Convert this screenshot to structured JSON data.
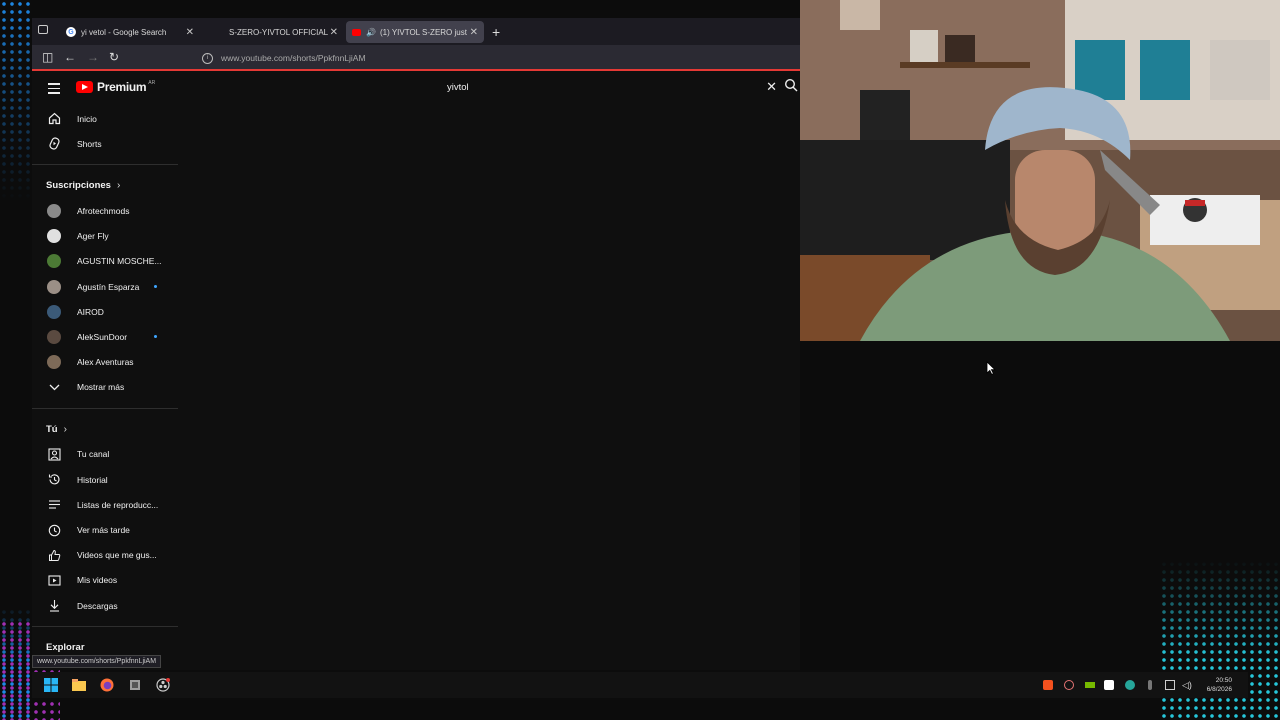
{
  "browser": {
    "tabs": [
      {
        "title": "yi vetol - Google Search",
        "favicon": "google-icon",
        "active": false
      },
      {
        "title": "S-ZERO-YIVTOL OFFICIAL",
        "favicon": "blank-page-icon",
        "active": false
      },
      {
        "title": "(1)  YIVTOL S-ZERO just",
        "favicon": "youtube-icon",
        "active": true
      }
    ],
    "url": "www.youtube.com/shorts/PpkfnnLjiAM",
    "status_link": "www.youtube.com/shorts/PpkfnnLjiAM"
  },
  "youtube": {
    "logo_text": "Premium",
    "country_code": "AR",
    "search_value": "yivtol",
    "nav": [
      {
        "label": "Inicio",
        "icon": "home-icon"
      },
      {
        "label": "Shorts",
        "icon": "shorts-icon"
      }
    ],
    "subscriptions_heading": "Suscripciones",
    "subscriptions": [
      {
        "label": "Afrotechmods",
        "color": "#8a8a8a",
        "new": false
      },
      {
        "label": "Ager Fly",
        "color": "#e0e0e0",
        "new": false
      },
      {
        "label": "AGUSTIN MOSCHE...",
        "color": "#4c7a35",
        "new": false
      },
      {
        "label": "Agustín Esparza",
        "color": "#9b8f86",
        "new": true
      },
      {
        "label": "AIROD",
        "color": "#3b5a78",
        "new": false
      },
      {
        "label": "AlekSunDoor",
        "color": "#5a4a40",
        "new": true
      },
      {
        "label": "Alex Aventuras",
        "color": "#7d6a58",
        "new": false
      }
    ],
    "show_more": "Mostrar más",
    "you_heading": "Tú",
    "you_items": [
      {
        "label": "Tu canal",
        "icon": "channel-icon"
      },
      {
        "label": "Historial",
        "icon": "history-icon"
      },
      {
        "label": "Listas de reproducc...",
        "icon": "playlists-icon"
      },
      {
        "label": "Ver más tarde",
        "icon": "watch-later-icon"
      },
      {
        "label": "Videos que me gus...",
        "icon": "liked-icon"
      },
      {
        "label": "Mis videos",
        "icon": "my-videos-icon"
      },
      {
        "label": "Descargas",
        "icon": "downloads-icon"
      }
    ],
    "explore_heading": "Explorar"
  },
  "taskbar": {
    "time": "20:50",
    "date": "6/8/2026"
  }
}
